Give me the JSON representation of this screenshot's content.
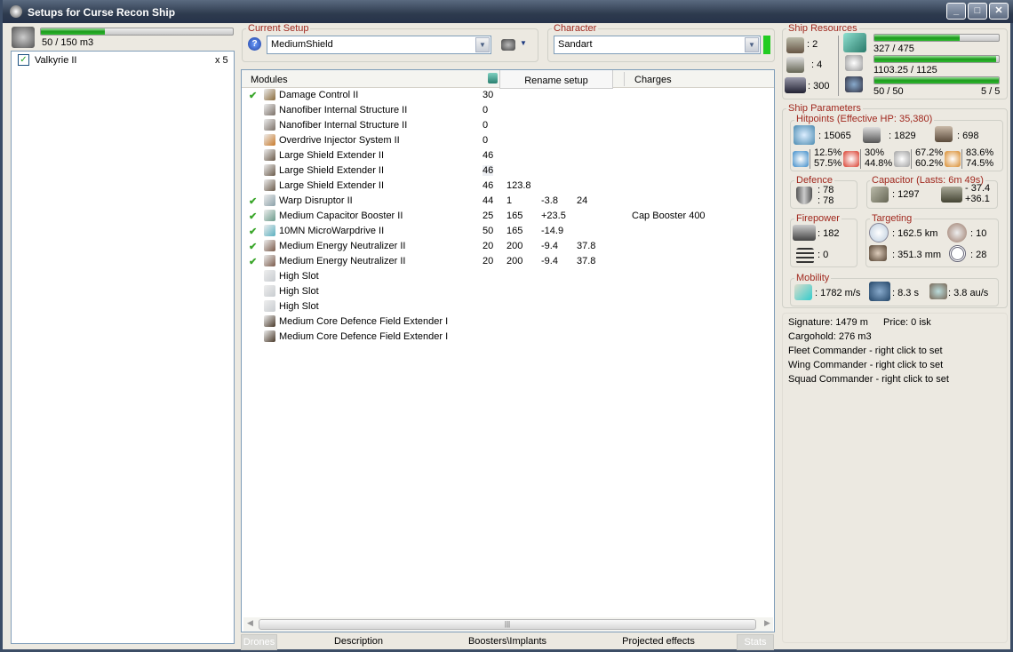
{
  "window": {
    "title": "Setups for Curse Recon Ship",
    "min": "_",
    "max": "□",
    "close": "✕"
  },
  "drone_bay": {
    "usage": "50 / 150 m3",
    "fill": 0.333,
    "drones": [
      {
        "name": "Valkyrie II",
        "count": "x 5",
        "checked": true
      }
    ]
  },
  "setup": {
    "label": "Current Setup",
    "value": "MediumShield",
    "help": "?"
  },
  "character": {
    "label": "Character",
    "value": "Sandart"
  },
  "table": {
    "headers": {
      "modules": "Modules",
      "rename": "Rename setup",
      "charges": "Charges"
    },
    "rows": [
      {
        "active": true,
        "name": "Damage Control II",
        "c1": "30",
        "c2": "",
        "c3": "",
        "c4": "",
        "charge": "",
        "color": "#8a6a3a"
      },
      {
        "active": false,
        "name": "Nanofiber Internal Structure II",
        "c1": "0",
        "c2": "",
        "c3": "",
        "c4": "",
        "charge": "",
        "color": "#7a6f66"
      },
      {
        "active": false,
        "name": "Nanofiber Internal Structure II",
        "c1": "0",
        "c2": "",
        "c3": "",
        "c4": "",
        "charge": "",
        "color": "#7a6f66"
      },
      {
        "active": false,
        "name": "Overdrive Injector System II",
        "c1": "0",
        "c2": "",
        "c3": "",
        "c4": "",
        "charge": "",
        "color": "#c87a2a"
      },
      {
        "active": false,
        "name": "Large Shield Extender II",
        "c1": "46",
        "c2": "",
        "c3": "",
        "c4": "",
        "charge": "",
        "color": "#6a5a4a"
      },
      {
        "active": false,
        "name": "Large Shield Extender II",
        "c1": "46",
        "c2": "",
        "c3": "",
        "c4": "",
        "charge": "",
        "color": "#6a5a4a"
      },
      {
        "active": false,
        "name": "Large Shield Extender II",
        "c1": "46",
        "c2": "123.8",
        "c3": "",
        "c4": "",
        "charge": "",
        "color": "#6a5a4a"
      },
      {
        "active": true,
        "name": "Warp Disruptor II",
        "c1": "44",
        "c2": "1",
        "c3": "-3.8",
        "c4": "24",
        "charge": "",
        "color": "#8aa0a8"
      },
      {
        "active": true,
        "name": "Medium Capacitor Booster II",
        "c1": "25",
        "c2": "165",
        "c3": "+23.5",
        "c4": "",
        "charge": "Cap Booster 400",
        "color": "#6a9a8a"
      },
      {
        "active": true,
        "name": "10MN MicroWarpdrive II",
        "c1": "50",
        "c2": "165",
        "c3": "-14.9",
        "c4": "",
        "charge": "",
        "color": "#5ab0c0"
      },
      {
        "active": true,
        "name": "Medium Energy Neutralizer II",
        "c1": "20",
        "c2": "200",
        "c3": "-9.4",
        "c4": "37.8",
        "charge": "",
        "color": "#7a5a4a"
      },
      {
        "active": true,
        "name": "Medium Energy Neutralizer II",
        "c1": "20",
        "c2": "200",
        "c3": "-9.4",
        "c4": "37.8",
        "charge": "",
        "color": "#7a5a4a"
      },
      {
        "active": false,
        "name": "High Slot",
        "c1": "",
        "c2": "",
        "c3": "",
        "c4": "",
        "charge": "",
        "color": "#c8ccd0"
      },
      {
        "active": false,
        "name": "High Slot",
        "c1": "",
        "c2": "",
        "c3": "",
        "c4": "",
        "charge": "",
        "color": "#c8ccd0"
      },
      {
        "active": false,
        "name": "High Slot",
        "c1": "",
        "c2": "",
        "c3": "",
        "c4": "",
        "charge": "",
        "color": "#c8ccd0"
      },
      {
        "active": false,
        "name": "Medium Core Defence Field Extender I",
        "c1": "",
        "c2": "",
        "c3": "",
        "c4": "",
        "charge": "",
        "color": "#4a3a2a"
      },
      {
        "active": false,
        "name": "Medium Core Defence Field Extender I",
        "c1": "",
        "c2": "",
        "c3": "",
        "c4": "",
        "charge": "",
        "color": "#4a3a2a"
      }
    ]
  },
  "tabs": {
    "drones": "Drones",
    "description": "Description",
    "boosters": "Boosters\\Implants",
    "projected": "Projected effects",
    "stats": "Stats"
  },
  "resources": {
    "label": "Ship Resources",
    "turrets": ": 2",
    "launchers": ": 4",
    "calibration": ": 300",
    "cpu": "327 / 475",
    "cpu_fill": 0.688,
    "power": "1103.25 / 1125",
    "power_fill": 0.98,
    "drone_bw": "50 / 50",
    "drone_bw_fill": 1.0,
    "drones_active": "5 / 5"
  },
  "params": {
    "label": "Ship Parameters",
    "hp_label": "Hitpoints (Effective HP: 35,380)",
    "shield": ": 15065",
    "armor": ": 1829",
    "structure": ": 698",
    "res": [
      {
        "a": "12.5%",
        "b": "57.5%",
        "color": "#3a8ac8"
      },
      {
        "a": "30%",
        "b": "44.8%",
        "color": "#d83a2a"
      },
      {
        "a": "67.2%",
        "b": "60.2%",
        "color": "#a0a0a0"
      },
      {
        "a": "83.6%",
        "b": "74.5%",
        "color": "#d88a2a"
      }
    ],
    "defence_label": "Defence",
    "def1": ": 78",
    "def2": ": 78",
    "cap_label": "Capacitor (Lasts: 6m 49s)",
    "cap": ": 1297",
    "cap_use": "- 37.4",
    "cap_regen": "+36.1",
    "fire_label": "Firepower",
    "dps": ": 182",
    "volley": ": 0",
    "target_label": "Targeting",
    "range": ": 162.5 km",
    "targets": ": 10",
    "scan": ": 351.3 mm",
    "sensor": ": 28",
    "mob_label": "Mobility",
    "speed": ": 1782 m/s",
    "align": ": 8.3 s",
    "warp": ": 3.8 au/s",
    "signature": "Signature: 1479 m",
    "price": "Price: 0 isk",
    "cargo": "Cargohold: 276 m3",
    "fleet": "Fleet Commander - right click to set",
    "wing": "Wing Commander - right click to set",
    "squad": "Squad Commander - right click to set"
  },
  "colors": {
    "accent": "#a0281e",
    "bar": "#1d9a1d"
  }
}
